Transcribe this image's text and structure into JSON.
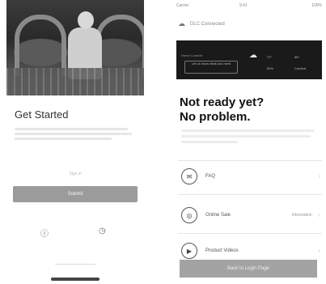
{
  "left": {
    "title": "Get Started",
    "small_note": "Sign in",
    "primary_button": "Submit",
    "icons": [
      "info-icon",
      "help-icon"
    ]
  },
  "right": {
    "status": {
      "time": "9:41",
      "carrier": "Carrier",
      "battery": "100%"
    },
    "header": {
      "logo": "☁",
      "title": "DLC Connected"
    },
    "banner": {
      "caption": "Home Comfort",
      "pill": "Let us know what you need",
      "weather_icon": "cloud-icon",
      "stats": [
        "72°",
        "68°",
        "80%",
        "Comfort"
      ]
    },
    "headline_line1": "Not ready yet?",
    "headline_line2": "No problem.",
    "menu": [
      {
        "icon": "chat-icon",
        "glyph": "✉",
        "label": "FAQ",
        "value": ""
      },
      {
        "icon": "globe-icon",
        "glyph": "◎",
        "label": "Online Sale",
        "value": "Information"
      },
      {
        "icon": "video-icon",
        "glyph": "▶",
        "label": "Product Videos",
        "value": ""
      }
    ],
    "cta": "Back to Login Page"
  }
}
